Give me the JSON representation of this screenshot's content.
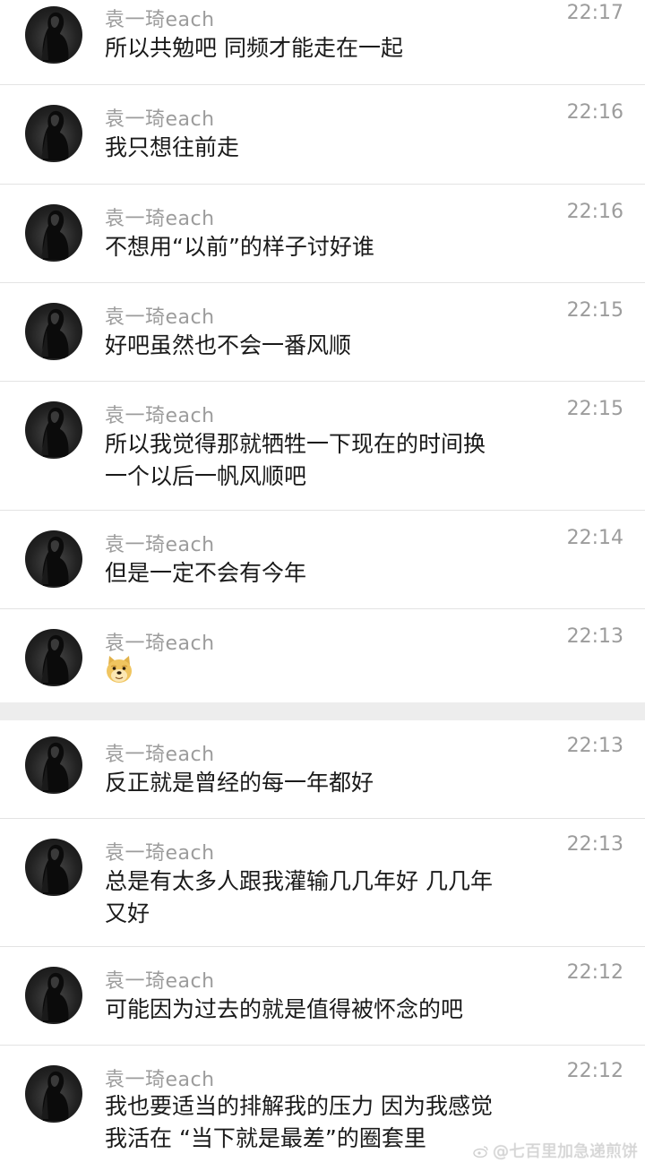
{
  "messages": [
    {
      "sender": "袁一琦each",
      "time": "22:17",
      "text": "所以共勉吧 同频才能走在一起"
    },
    {
      "sender": "袁一琦each",
      "time": "22:16",
      "text": "我只想往前走"
    },
    {
      "sender": "袁一琦each",
      "time": "22:16",
      "text": "不想用“以前”的样子讨好谁"
    },
    {
      "sender": "袁一琦each",
      "time": "22:15",
      "text": "好吧虽然也不会一番风顺"
    },
    {
      "sender": "袁一琦each",
      "time": "22:15",
      "text": "所以我觉得那就牺牲一下现在的时间换\n一个以后一帆风顺吧"
    },
    {
      "sender": "袁一琦each",
      "time": "22:14",
      "text": "但是一定不会有今年"
    },
    {
      "sender": "袁一琦each",
      "time": "22:13",
      "text": "",
      "emoji": "doge-emoji"
    },
    {
      "sender": "袁一琦each",
      "time": "22:13",
      "text": "反正就是曾经的每一年都好"
    },
    {
      "sender": "袁一琦each",
      "time": "22:13",
      "text": "总是有太多人跟我灌输几几年好 几几年\n又好"
    },
    {
      "sender": "袁一琦each",
      "time": "22:12",
      "text": "可能因为过去的就是值得被怀念的吧"
    },
    {
      "sender": "袁一琦each",
      "time": "22:12",
      "text": "我也要适当的排解我的压力 因为我感觉\n我活在 “当下就是最差”的圈套里"
    }
  ],
  "watermark": {
    "text": "@七百里加急递煎饼",
    "icon": "weibo-icon"
  },
  "colors": {
    "meta": "#9c9c9c",
    "text": "#1a1a1a",
    "divider": "#e3e3e3",
    "separator": "#ededed"
  }
}
